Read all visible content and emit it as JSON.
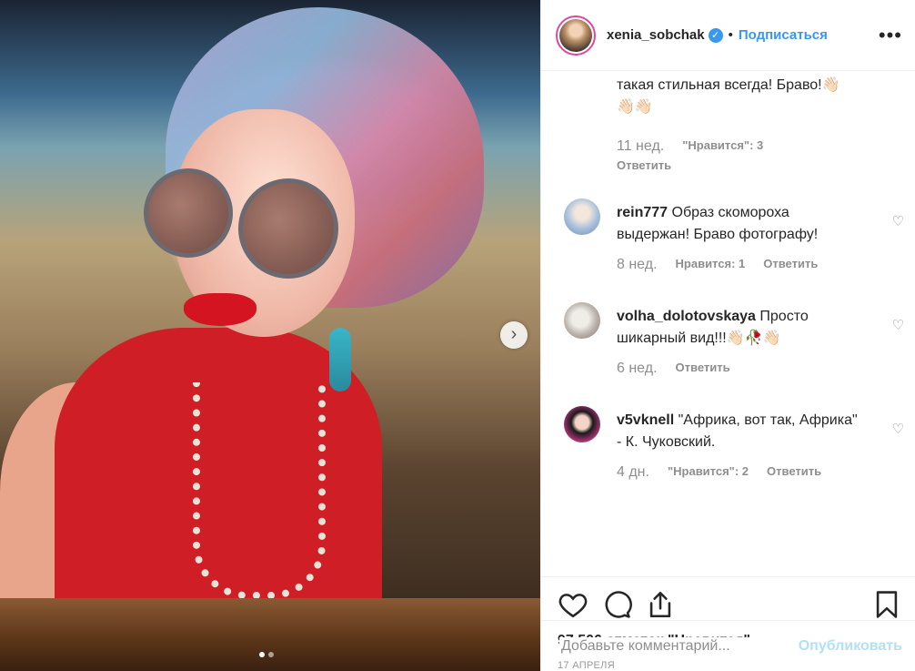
{
  "header": {
    "username": "xenia_sobchak",
    "verified_icon": "verified-badge",
    "separator": "•",
    "follow_label": "Подписаться",
    "more_label": "•••"
  },
  "photo": {
    "next_label": "›",
    "slide_count": 2,
    "active_slide": 1
  },
  "comments": {
    "partial_top_text": "такая стильная всегда! Браво!👋🏻\n👋🏻👋🏻",
    "partial_meta": {
      "age": "11 нед.",
      "likes": "\"Нравится\": 3",
      "reply": "Ответить"
    },
    "items": [
      {
        "username": "rein777",
        "text": "Образ скомороха выдержан! Браво фотографу!",
        "age": "8 нед.",
        "likes": "Нравится: 1",
        "reply": "Ответить"
      },
      {
        "username": "volha_dolotovskaya",
        "text": "Просто шикарный вид!!!👋🏻🥀👋🏻",
        "age": "6 нед.",
        "likes": "",
        "reply": "Ответить"
      },
      {
        "username": "v5vknell",
        "text": "\"Африка, вот так, Африка\" - К. Чуковский.",
        "age": "4 дн.",
        "likes": "\"Нравится\": 2",
        "reply": "Ответить"
      }
    ]
  },
  "footer": {
    "likes_count": "97 506 отметок \"Нравится\"",
    "date": "17 АПРЕЛЯ",
    "comment_placeholder": "Добавьте комментарий...",
    "post_label": "Опубликовать"
  },
  "colors": {
    "accent": "#3897f0",
    "muted": "#8e8e8e",
    "post_disabled": "#b2dffc"
  }
}
